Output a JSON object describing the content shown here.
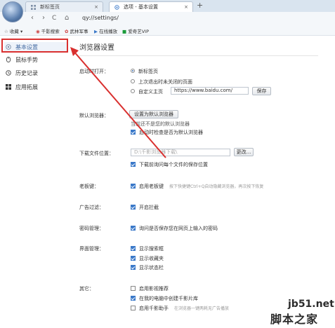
{
  "browser": {
    "tabs": [
      {
        "label": "新标签页",
        "icon": "grid-icon",
        "active": false
      },
      {
        "label": "选项 - 基本设置",
        "icon": "settings-icon",
        "active": true
      }
    ],
    "new_tab_label": "+",
    "close_label": "×",
    "nav": {
      "back": "‹",
      "forward": "›",
      "reload": "C",
      "home": "⌂"
    },
    "address": "qy://settings/",
    "bookmarks": [
      {
        "label": "收藏",
        "icon": "star-icon",
        "suffix": "▾"
      },
      {
        "label": "千影搜索",
        "icon": "film-icon"
      },
      {
        "label": "武林军事",
        "icon": "paw-icon"
      },
      {
        "label": "在线播放",
        "icon": "play-icon"
      },
      {
        "label": "爱奇艺VIP",
        "icon": "iqiyi-icon"
      }
    ]
  },
  "sidebar": {
    "items": [
      {
        "label": "基本设置",
        "icon": "gear-icon",
        "selected": true
      },
      {
        "label": "鼠标手势",
        "icon": "mouse-icon",
        "selected": false
      },
      {
        "label": "历史记录",
        "icon": "clock-icon",
        "selected": false
      },
      {
        "label": "应用拓展",
        "icon": "apps-icon",
        "selected": false
      }
    ]
  },
  "main": {
    "title": "浏览器设置",
    "startup": {
      "label": "启动时打开：",
      "options": [
        "新标签页",
        "上次退出时未关闭的页面",
        "自定义主页"
      ],
      "selected": 0,
      "homepage_value": "https://www.baidu.com/",
      "save_label": "保存"
    },
    "default_browser": {
      "label": "默认浏览器：",
      "button": "设置为默认浏览器",
      "status": "当前还不是您的默认浏览器",
      "check_label": "启动时检查是否为默认浏览器",
      "checked": true
    },
    "download": {
      "label": "下载文件位置：",
      "path_placeholder": "D:\\千影浏览器下载\\",
      "change_label": "更改...",
      "ask_label": "下载前询问每个文件的保存位置",
      "checked": true
    },
    "boss_key": {
      "label": "老板键：",
      "option": "启用老板键",
      "hint": "按下快捷键Ctrl+Q自动隐藏浏览器，再次按下恢复",
      "checked": true
    },
    "ad_filter": {
      "label": "广告过滤：",
      "option": "开启拦截",
      "checked": true
    },
    "password": {
      "label": "密码管理：",
      "option": "询问是否保存您在网页上输入的密码",
      "checked": true
    },
    "interface": {
      "label": "界面管理：",
      "options": [
        {
          "label": "显示搜索框",
          "checked": true
        },
        {
          "label": "显示收藏夹",
          "checked": true
        },
        {
          "label": "显示状态栏",
          "checked": true
        }
      ]
    },
    "other": {
      "label": "其它：",
      "options": [
        {
          "label": "启用影视推荐",
          "checked": false,
          "hint": ""
        },
        {
          "label": "在我的电脑中创建千影片库",
          "checked": true,
          "hint": ""
        },
        {
          "label": "启用千影助手",
          "checked": false,
          "hint": "在浏览器一键两耗无广告播放"
        }
      ]
    }
  },
  "watermark": {
    "line1": "jb51.net",
    "line2": "脚本之家"
  },
  "colors": {
    "accent": "#3b79c9",
    "highlight": "#d9302f",
    "tabbar": "#d9e4ef"
  }
}
